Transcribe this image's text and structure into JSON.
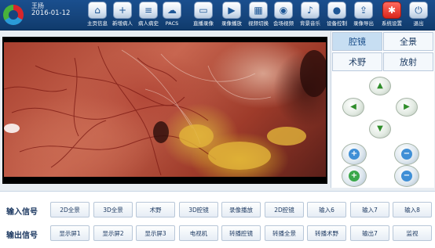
{
  "header": {
    "user": "王扬",
    "date": "2016-01-12",
    "tools": [
      {
        "label": "主页信息",
        "icon": "home-icon",
        "glyph": "⌂",
        "style": ""
      },
      {
        "label": "新增病人",
        "icon": "add-patient-icon",
        "glyph": "+",
        "style": ""
      },
      {
        "label": "病人病史",
        "icon": "history-icon",
        "glyph": "≡",
        "style": ""
      },
      {
        "label": "PACS",
        "icon": "pacs-icon",
        "glyph": "☁",
        "style": ""
      },
      {
        "label": "直播录像",
        "icon": "live-record-icon",
        "glyph": "▭",
        "style": ""
      },
      {
        "label": "录像播放",
        "icon": "play-icon",
        "glyph": "▶",
        "style": ""
      },
      {
        "label": "视频切换",
        "icon": "video-switch-icon",
        "glyph": "▦",
        "style": ""
      },
      {
        "label": "会场视频",
        "icon": "conference-video-icon",
        "glyph": "◉",
        "style": ""
      },
      {
        "label": "背景音乐",
        "icon": "music-icon",
        "glyph": "♪",
        "style": ""
      },
      {
        "label": "设备控制",
        "icon": "device-control-icon",
        "glyph": "●",
        "style": ""
      },
      {
        "label": "录像导出",
        "icon": "export-icon",
        "glyph": "⇪",
        "style": ""
      },
      {
        "label": "系统设置",
        "icon": "settings-icon",
        "glyph": "✱",
        "style": "red"
      },
      {
        "label": "退出",
        "icon": "exit-icon",
        "glyph": "⏻",
        "style": ""
      }
    ]
  },
  "panel": {
    "modes": [
      {
        "label": "腔镜",
        "active": true
      },
      {
        "label": "全景",
        "active": false
      },
      {
        "label": "术野",
        "active": false
      },
      {
        "label": "放射",
        "active": false
      }
    ],
    "ptz": {
      "up": "▲",
      "left": "◀",
      "right": "▶",
      "down": "▼",
      "zoom_in": "+",
      "zoom_out": "−",
      "focus_near": "+",
      "focus_far": "−"
    }
  },
  "signals": {
    "input_label": "输入信号",
    "output_label": "输出信号",
    "inputs": [
      "2D全景",
      "3D全景",
      "术野",
      "3D腔镜",
      "录像播放",
      "2D腔镜",
      "输入6",
      "输入7",
      "输入8"
    ],
    "outputs": [
      "显示屏1",
      "显示屏2",
      "显示屏3",
      "电视机",
      "转播腔镜",
      "转播全景",
      "转播术野",
      "输出7",
      "监视"
    ]
  }
}
